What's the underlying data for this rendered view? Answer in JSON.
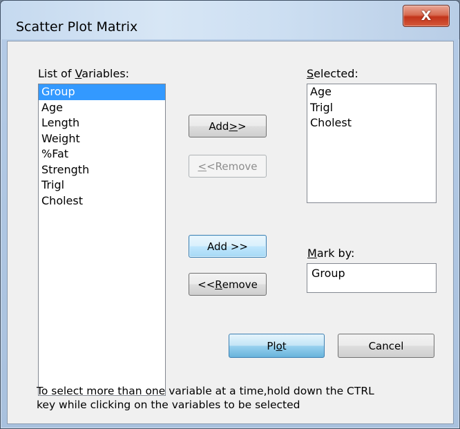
{
  "window": {
    "title": "Scatter Plot Matrix",
    "close_symbol": "X"
  },
  "variables": {
    "label_pre": "List of ",
    "label_accel": "V",
    "label_post": "ariables:",
    "items": [
      "Group",
      "Age",
      "Length",
      "Weight",
      "%Fat",
      "Strength",
      "Trigl",
      "Cholest"
    ],
    "selected_index": 0
  },
  "selected": {
    "label_accel": "S",
    "label_post": "elected:",
    "items": [
      "Age",
      "Trigl",
      "Cholest"
    ]
  },
  "buttons": {
    "add_top_pre": "Add ",
    "add_top_accel": ">",
    "add_top_post": ">",
    "remove_top_pre": "<",
    "remove_top_accel": "<",
    "remove_top_post": " Remove",
    "add_mark": "Add >>",
    "remove_mark_pre": "<< ",
    "remove_mark_accel": "R",
    "remove_mark_post": "emove",
    "plot_pre": "Pl",
    "plot_accel": "o",
    "plot_post": "t",
    "cancel": "Cancel"
  },
  "mark_by": {
    "label_accel": "M",
    "label_post": "ark by:",
    "value": "Group"
  },
  "hint": {
    "line1": "To select more than one variable at a time,hold down the CTRL",
    "line2": "key while clicking on the variables to be selected"
  }
}
